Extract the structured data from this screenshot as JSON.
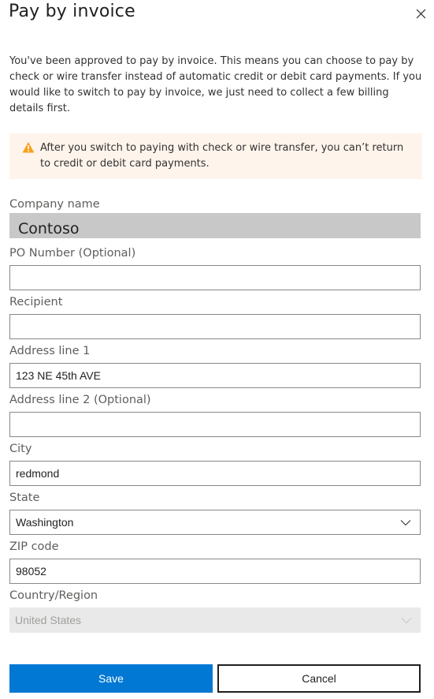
{
  "dialog": {
    "title": "Pay by invoice",
    "description": "You've been approved to pay by invoice. This means you can choose to pay by check or wire transfer instead of automatic credit or debit card payments. If you would like to switch to pay by invoice, we just need to collect a few billing details first.",
    "warning": "After you switch to paying with check or wire transfer, you can’t return to credit or debit card payments.",
    "warning_color": "#f7a21b",
    "warning_bg": "#fff4ec"
  },
  "form": {
    "company": {
      "label": "Company name",
      "value": "Contoso"
    },
    "po_number": {
      "label": "PO Number (Optional)",
      "value": ""
    },
    "recipient": {
      "label": "Recipient",
      "value": ""
    },
    "address1": {
      "label": "Address line 1",
      "value": "123 NE 45th AVE"
    },
    "address2": {
      "label": "Address line 2 (Optional)",
      "value": ""
    },
    "city": {
      "label": "City",
      "value": "redmond"
    },
    "state": {
      "label": "State",
      "value": "Washington"
    },
    "zip": {
      "label": "ZIP code",
      "value": "98052"
    },
    "country": {
      "label": "Country/Region",
      "value": "United States"
    }
  },
  "buttons": {
    "save": "Save",
    "cancel": "Cancel",
    "primary_color": "#0078d4"
  }
}
